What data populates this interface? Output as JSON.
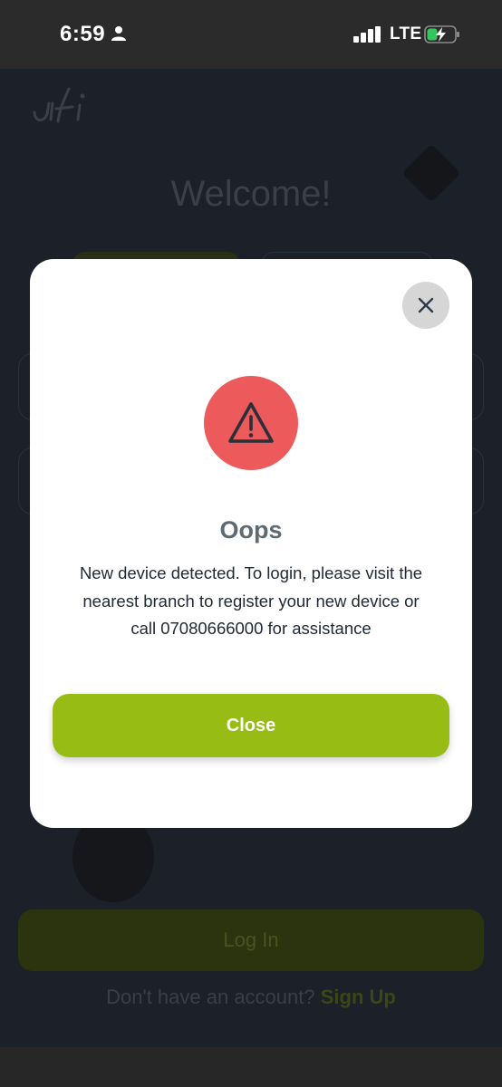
{
  "status_bar": {
    "time": "6:59",
    "network": "LTE",
    "icons": [
      "person-icon",
      "signal-icon",
      "battery-charging-icon"
    ]
  },
  "background": {
    "welcome": "Welcome!",
    "login_button": "Log In",
    "signup_prompt": "Don't have an account?",
    "signup_link": "Sign Up"
  },
  "modal": {
    "title": "Oops",
    "message": "New device detected. To login, please visit the nearest branch to register your new device or call 07080666000 for assistance",
    "close_button": "Close",
    "icons": [
      "close-icon",
      "warning-icon"
    ]
  },
  "colors": {
    "accent": "#97bd14",
    "warning": "#ec5a5c",
    "overlay": "#1c2028"
  }
}
